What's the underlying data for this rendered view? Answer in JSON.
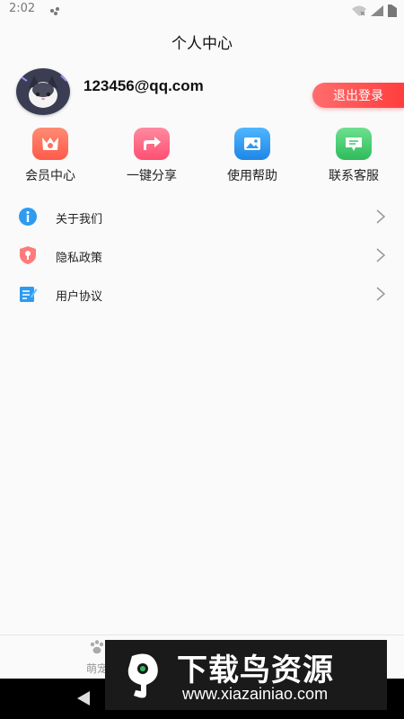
{
  "status_bar": {
    "time": "2:02"
  },
  "header": {
    "title": "个人中心"
  },
  "profile": {
    "email": "123456@qq.com",
    "logout_label": "退出登录"
  },
  "quick_actions": [
    {
      "label": "会员中心",
      "icon": "crown-icon",
      "color": "#ff6f61"
    },
    {
      "label": "一键分享",
      "icon": "share-icon",
      "color": "#ff5f80"
    },
    {
      "label": "使用帮助",
      "icon": "image-icon",
      "color": "#2e9bf0"
    },
    {
      "label": "联系客服",
      "icon": "message-icon",
      "color": "#3cc96a"
    }
  ],
  "menu": [
    {
      "label": "关于我们",
      "icon": "info-icon"
    },
    {
      "label": "隐私政策",
      "icon": "shield-icon"
    },
    {
      "label": "用户协议",
      "icon": "document-icon"
    }
  ],
  "tab_bar": {
    "tab1_label": "萌宠"
  },
  "watermark": {
    "title": "下载鸟资源",
    "url": "www.xiazainiao.com"
  }
}
